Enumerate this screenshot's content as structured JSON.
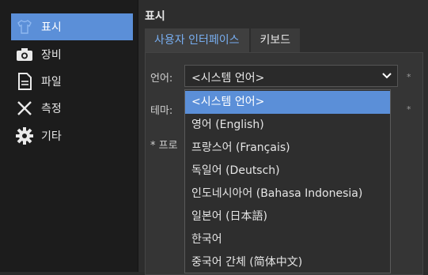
{
  "sidebar": {
    "items": [
      {
        "label": "표시",
        "icon": "shirt-icon"
      },
      {
        "label": "장비",
        "icon": "camera-icon"
      },
      {
        "label": "파일",
        "icon": "file-icon"
      },
      {
        "label": "측정",
        "icon": "scissors-icon"
      },
      {
        "label": "기타",
        "icon": "gear-icon"
      }
    ]
  },
  "main": {
    "title": "표시",
    "tabs": [
      {
        "label": "사용자 인터페이스"
      },
      {
        "label": "키보드"
      }
    ],
    "language_label": "언어:",
    "language_value": "<시스템 언어>",
    "theme_label": "테마:",
    "note_prefix": "* 프로"
  },
  "dropdown": {
    "options": [
      "<시스템 언어>",
      "영어 (English)",
      "프랑스어 (Français)",
      "독일어 (Deutsch)",
      "인도네시아어 (Bahasa Indonesia)",
      "일본어 (日本語)",
      "한국어",
      "중국어 간체 (简体中文)"
    ]
  },
  "colors": {
    "accent": "#5b8fd8",
    "tab_active_text": "#78aef0",
    "sidebar_bg": "#1c1c1c"
  }
}
